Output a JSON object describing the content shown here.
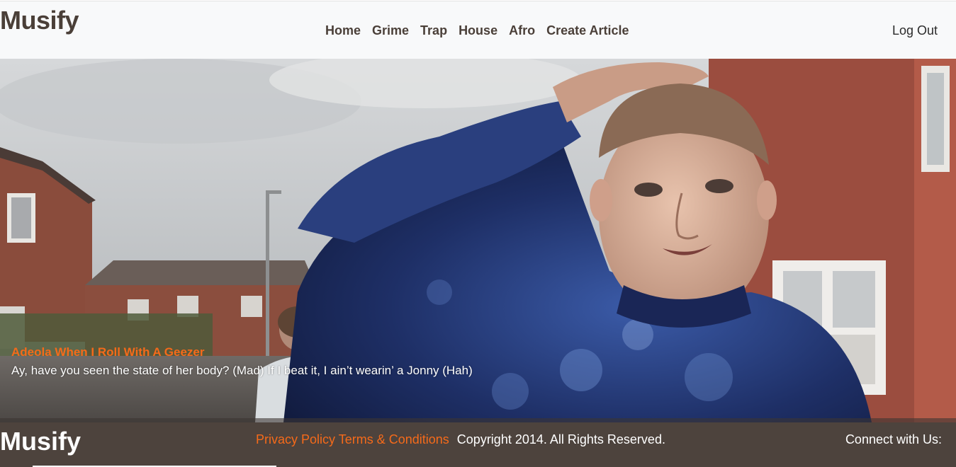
{
  "header": {
    "brand": "Musify",
    "nav": [
      {
        "label": "Home"
      },
      {
        "label": "Grime"
      },
      {
        "label": "Trap"
      },
      {
        "label": "House"
      },
      {
        "label": "Afro"
      },
      {
        "label": "Create Article"
      }
    ],
    "logout_label": "Log Out"
  },
  "hero": {
    "image_subject": "young-man-street-photo",
    "caption_title": "Adeola When I Roll With A Geezer",
    "caption_text": "Ay, have you seen the state of her body? (Mad) If I beat it, I ain’t wearin’ a Jonny (Hah)"
  },
  "footer": {
    "brand": "Musify",
    "privacy_label": "Privacy Policy",
    "terms_label": "Terms & Conditions",
    "copyright": "Copyright 2014.  All Rights Reserved.",
    "connect_label": "Connect with Us:"
  },
  "colors": {
    "accent": "#f56a1a",
    "header_bg": "#f8f9fa",
    "footer_bg": "#4d433d",
    "brand_text": "#4a3f38"
  }
}
